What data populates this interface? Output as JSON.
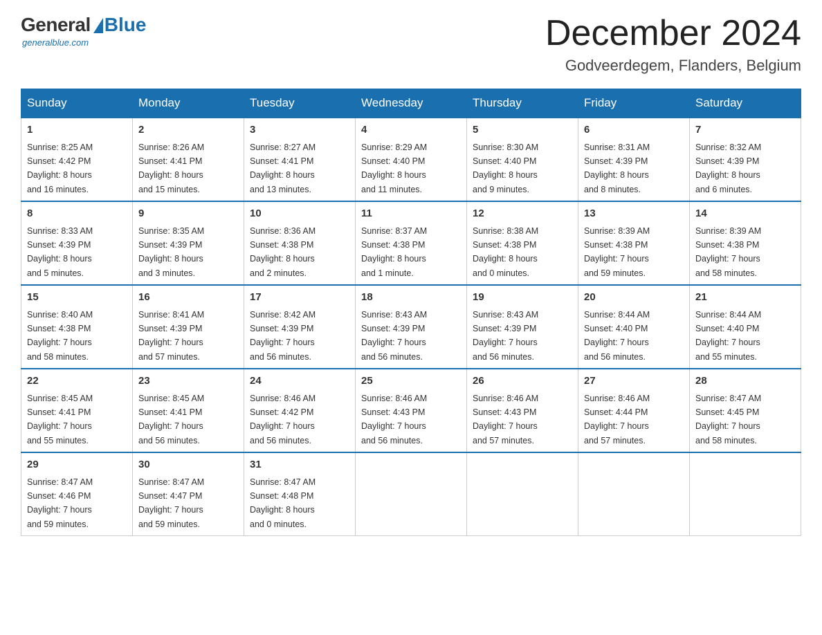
{
  "header": {
    "logo": {
      "general": "General",
      "blue": "Blue",
      "subtitle": "generalblue.com"
    },
    "title": "December 2024",
    "location": "Godveerdegem, Flanders, Belgium"
  },
  "days_of_week": [
    "Sunday",
    "Monday",
    "Tuesday",
    "Wednesday",
    "Thursday",
    "Friday",
    "Saturday"
  ],
  "weeks": [
    [
      {
        "day": "1",
        "sunrise": "8:25 AM",
        "sunset": "4:42 PM",
        "daylight": "8 hours and 16 minutes."
      },
      {
        "day": "2",
        "sunrise": "8:26 AM",
        "sunset": "4:41 PM",
        "daylight": "8 hours and 15 minutes."
      },
      {
        "day": "3",
        "sunrise": "8:27 AM",
        "sunset": "4:41 PM",
        "daylight": "8 hours and 13 minutes."
      },
      {
        "day": "4",
        "sunrise": "8:29 AM",
        "sunset": "4:40 PM",
        "daylight": "8 hours and 11 minutes."
      },
      {
        "day": "5",
        "sunrise": "8:30 AM",
        "sunset": "4:40 PM",
        "daylight": "8 hours and 9 minutes."
      },
      {
        "day": "6",
        "sunrise": "8:31 AM",
        "sunset": "4:39 PM",
        "daylight": "8 hours and 8 minutes."
      },
      {
        "day": "7",
        "sunrise": "8:32 AM",
        "sunset": "4:39 PM",
        "daylight": "8 hours and 6 minutes."
      }
    ],
    [
      {
        "day": "8",
        "sunrise": "8:33 AM",
        "sunset": "4:39 PM",
        "daylight": "8 hours and 5 minutes."
      },
      {
        "day": "9",
        "sunrise": "8:35 AM",
        "sunset": "4:39 PM",
        "daylight": "8 hours and 3 minutes."
      },
      {
        "day": "10",
        "sunrise": "8:36 AM",
        "sunset": "4:38 PM",
        "daylight": "8 hours and 2 minutes."
      },
      {
        "day": "11",
        "sunrise": "8:37 AM",
        "sunset": "4:38 PM",
        "daylight": "8 hours and 1 minute."
      },
      {
        "day": "12",
        "sunrise": "8:38 AM",
        "sunset": "4:38 PM",
        "daylight": "8 hours and 0 minutes."
      },
      {
        "day": "13",
        "sunrise": "8:39 AM",
        "sunset": "4:38 PM",
        "daylight": "7 hours and 59 minutes."
      },
      {
        "day": "14",
        "sunrise": "8:39 AM",
        "sunset": "4:38 PM",
        "daylight": "7 hours and 58 minutes."
      }
    ],
    [
      {
        "day": "15",
        "sunrise": "8:40 AM",
        "sunset": "4:38 PM",
        "daylight": "7 hours and 58 minutes."
      },
      {
        "day": "16",
        "sunrise": "8:41 AM",
        "sunset": "4:39 PM",
        "daylight": "7 hours and 57 minutes."
      },
      {
        "day": "17",
        "sunrise": "8:42 AM",
        "sunset": "4:39 PM",
        "daylight": "7 hours and 56 minutes."
      },
      {
        "day": "18",
        "sunrise": "8:43 AM",
        "sunset": "4:39 PM",
        "daylight": "7 hours and 56 minutes."
      },
      {
        "day": "19",
        "sunrise": "8:43 AM",
        "sunset": "4:39 PM",
        "daylight": "7 hours and 56 minutes."
      },
      {
        "day": "20",
        "sunrise": "8:44 AM",
        "sunset": "4:40 PM",
        "daylight": "7 hours and 56 minutes."
      },
      {
        "day": "21",
        "sunrise": "8:44 AM",
        "sunset": "4:40 PM",
        "daylight": "7 hours and 55 minutes."
      }
    ],
    [
      {
        "day": "22",
        "sunrise": "8:45 AM",
        "sunset": "4:41 PM",
        "daylight": "7 hours and 55 minutes."
      },
      {
        "day": "23",
        "sunrise": "8:45 AM",
        "sunset": "4:41 PM",
        "daylight": "7 hours and 56 minutes."
      },
      {
        "day": "24",
        "sunrise": "8:46 AM",
        "sunset": "4:42 PM",
        "daylight": "7 hours and 56 minutes."
      },
      {
        "day": "25",
        "sunrise": "8:46 AM",
        "sunset": "4:43 PM",
        "daylight": "7 hours and 56 minutes."
      },
      {
        "day": "26",
        "sunrise": "8:46 AM",
        "sunset": "4:43 PM",
        "daylight": "7 hours and 57 minutes."
      },
      {
        "day": "27",
        "sunrise": "8:46 AM",
        "sunset": "4:44 PM",
        "daylight": "7 hours and 57 minutes."
      },
      {
        "day": "28",
        "sunrise": "8:47 AM",
        "sunset": "4:45 PM",
        "daylight": "7 hours and 58 minutes."
      }
    ],
    [
      {
        "day": "29",
        "sunrise": "8:47 AM",
        "sunset": "4:46 PM",
        "daylight": "7 hours and 59 minutes."
      },
      {
        "day": "30",
        "sunrise": "8:47 AM",
        "sunset": "4:47 PM",
        "daylight": "7 hours and 59 minutes."
      },
      {
        "day": "31",
        "sunrise": "8:47 AM",
        "sunset": "4:48 PM",
        "daylight": "8 hours and 0 minutes."
      },
      null,
      null,
      null,
      null
    ]
  ]
}
